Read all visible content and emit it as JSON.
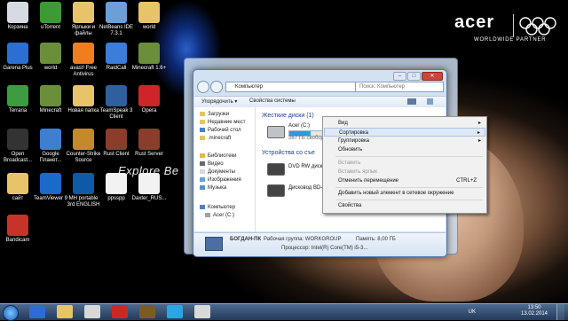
{
  "brand": {
    "name": "acer",
    "partner": "WORLDWIDE PARTNER"
  },
  "wallpaper": {
    "text": "Explore Be"
  },
  "desktop_icons": [
    {
      "label": "Корзина",
      "icon": "recycle-bin-icon",
      "color": "#d6dbe3"
    },
    {
      "label": "uTorrent",
      "icon": "utorrent-icon",
      "color": "#3d9b35"
    },
    {
      "label": "Ярлыки и файлы",
      "icon": "folder-icon",
      "color": "#e7c46a"
    },
    {
      "label": "NetBeans IDE 7.3.1",
      "icon": "netbeans-icon",
      "color": "#6a9fd8"
    },
    {
      "label": "world",
      "icon": "folder-icon",
      "color": "#e7c46a"
    },
    {
      "label": "Garena Plus",
      "icon": "garena-icon",
      "color": "#2a6fd1"
    },
    {
      "label": "world",
      "icon": "minecraft-icon",
      "color": "#6b8e3a"
    },
    {
      "label": "avast! Free Antivirus",
      "icon": "avast-icon",
      "color": "#f07d1e"
    },
    {
      "label": "RaidCall",
      "icon": "raidcall-icon",
      "color": "#3b7dd8"
    },
    {
      "label": "Minecraft 1.6+",
      "icon": "minecraft-icon",
      "color": "#6b8e3a"
    },
    {
      "label": "Terraria",
      "icon": "terraria-icon",
      "color": "#3c9c3f"
    },
    {
      "label": "Minecraft",
      "icon": "minecraft-icon",
      "color": "#6b8e3a"
    },
    {
      "label": "Новая папка",
      "icon": "folder-icon",
      "color": "#e7c46a"
    },
    {
      "label": "TeamSpeak 3 Client",
      "icon": "teamspeak-icon",
      "color": "#2f5f9c"
    },
    {
      "label": "Opera",
      "icon": "opera-icon",
      "color": "#d0242b"
    },
    {
      "label": "Open Broadcast...",
      "icon": "obs-icon",
      "color": "#333333"
    },
    {
      "label": "Google Планет...",
      "icon": "google-earth-icon",
      "color": "#3e7fcf"
    },
    {
      "label": "Counter-Strike Source",
      "icon": "counter-strike-icon",
      "color": "#c48a2a"
    },
    {
      "label": "Rust Client",
      "icon": "rust-icon",
      "color": "#8a3d2b"
    },
    {
      "label": "Rust Server",
      "icon": "rust-icon",
      "color": "#8a3d2b"
    },
    {
      "label": "сайт",
      "icon": "folder-icon",
      "color": "#e7c46a"
    },
    {
      "label": "TeamViewer 9",
      "icon": "teamviewer-icon",
      "color": "#1b6ac9"
    },
    {
      "label": "MH portable 3rd ENGLISH",
      "icon": "mh-icon",
      "color": "#0e5aa8"
    },
    {
      "label": "ppsspp",
      "icon": "file-icon",
      "color": "#f2f2f2"
    },
    {
      "label": "Daxter_RUS...",
      "icon": "file-icon",
      "color": "#f2f2f2"
    },
    {
      "label": "Bandicam",
      "icon": "bandicam-icon",
      "color": "#c7322b"
    }
  ],
  "explorer": {
    "address": "Компьютер",
    "search_placeholder": "Поиск: Компьютер",
    "toolbar": {
      "organize": "Упорядочить ▾",
      "system_props": "Свойства системы"
    },
    "nav_items": [
      "Загрузки",
      "Недавние мест",
      "Рабочий стол",
      ".minecraft",
      "Библиотеки",
      "Видео",
      "Документы",
      "Изображения",
      "Музыка",
      "Компьютер",
      "Acer (C:)"
    ],
    "groups": {
      "hard_disks": "Жесткие диски (1)",
      "removable": "Устройства со съе"
    },
    "drives": [
      {
        "name": "Acer (C:)",
        "free": "267 ГБ свобод",
        "used_fraction": 0.4
      },
      {
        "name": "DVD RW диско",
        "free": ""
      },
      {
        "name": "Дисковод BD-",
        "free": ""
      }
    ],
    "details": {
      "pc_name": "БОГДАН-ПК",
      "workgroup": "Рабочая группа: WORKGROUP",
      "memory": "Память: 8,00 ГБ",
      "processor": "Процессор: Intel(R) Core(TM) i5-3..."
    }
  },
  "context_menu": {
    "items": [
      {
        "label": "Вид",
        "arrow": "▸"
      },
      {
        "label": "Сортировка",
        "arrow": "▸"
      },
      {
        "label": "Группировка",
        "arrow": "▸"
      },
      {
        "label": "Обновить"
      },
      {
        "label": "Вставить",
        "disabled": true
      },
      {
        "label": "Вставить ярлык",
        "disabled": true
      },
      {
        "label": "Отменить перемещение",
        "shortcut": "CTRL+Z"
      },
      {
        "label": "Добавить новый элемент в сетевое окружение"
      },
      {
        "label": "Свойства"
      }
    ]
  },
  "taskbar": {
    "lang": "UK",
    "time": "13:50",
    "date": "13.02.2014",
    "apps": [
      "start-icon",
      "ie-icon",
      "explorer-icon",
      "media-icon",
      "opera-icon",
      "wow-icon",
      "skype-icon",
      "calculator-icon"
    ]
  }
}
